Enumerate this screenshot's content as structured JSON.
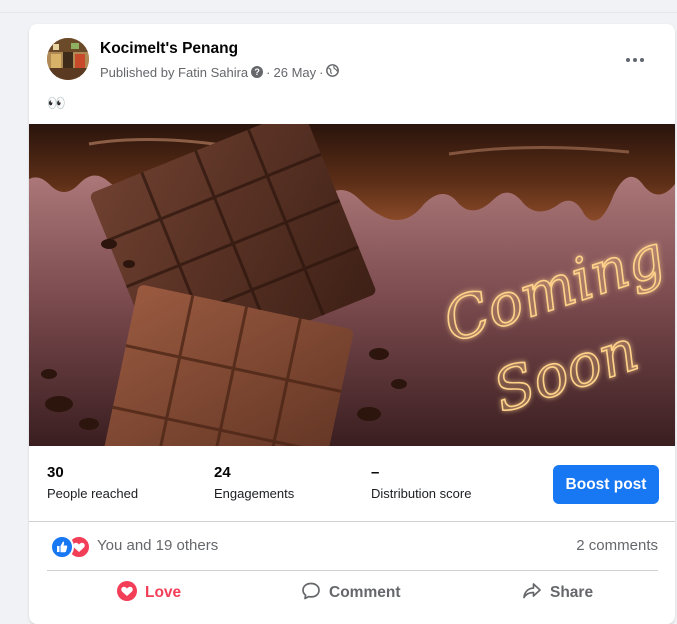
{
  "post": {
    "page_name": "Kocimelt's Penang",
    "published_by": "Published by Fatin Sahira",
    "date": "26 May",
    "separator": "·",
    "text": "👀",
    "image_text": "Coming Soon"
  },
  "stats": {
    "people_reached": {
      "value": "30",
      "label": "People reached"
    },
    "engagements": {
      "value": "24",
      "label": "Engagements"
    },
    "distribution": {
      "value": "–",
      "label": "Distribution score"
    },
    "boost_label": "Boost post"
  },
  "reactions": {
    "text": "You and 19 others",
    "comments": "2 comments"
  },
  "actions": {
    "love": "Love",
    "comment": "Comment",
    "share": "Share"
  },
  "colors": {
    "accent": "#1877f2",
    "love": "#f33e58",
    "secondary_text": "#65676b"
  },
  "icons": [
    "question-icon",
    "globe-icon",
    "more-icon",
    "like-reaction-icon",
    "love-reaction-icon",
    "love-icon",
    "comment-icon",
    "share-icon"
  ]
}
